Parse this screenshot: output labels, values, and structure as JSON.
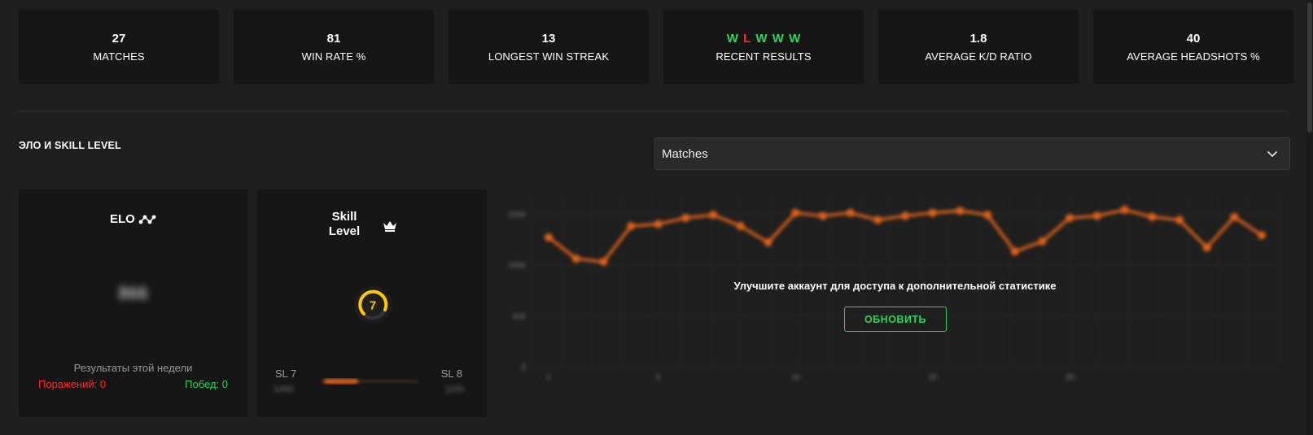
{
  "stats": [
    {
      "value": "27",
      "label": "MATCHES"
    },
    {
      "value": "81",
      "label": "WIN RATE %"
    },
    {
      "value": "13",
      "label": "LONGEST WIN STREAK"
    },
    {
      "value": "",
      "label": "RECENT RESULTS"
    },
    {
      "value": "1.8",
      "label": "AVERAGE K/D RATIO"
    },
    {
      "value": "40",
      "label": "AVERAGE HEADSHOTS %"
    }
  ],
  "recent_results": [
    "W",
    "L",
    "W",
    "W",
    "W"
  ],
  "section": {
    "title": "ЭЛО И SKILL LEVEL"
  },
  "select": {
    "value": "Matches"
  },
  "elo": {
    "title": "ELO",
    "value": "866",
    "week_label": "Результаты этой недели",
    "losses": "Поражений: 0",
    "wins": "Побед: 0"
  },
  "skill": {
    "title_line1": "Skill",
    "title_line2": "Level",
    "level": "7",
    "left_label": "SL 7",
    "right_label": "SL 8",
    "left_sub": "1000",
    "right_sub": "1150"
  },
  "upgrade": {
    "message": "Улучшите аккаунт для доступа к дополнительной статистике",
    "button": "ОБНОВИТЬ"
  },
  "colors": {
    "win": "#32d35a",
    "loss": "#ff2b2b",
    "line": "#e0621a",
    "skill": "#ffc800"
  },
  "chart_data": {
    "type": "line",
    "x": [
      1,
      2,
      3,
      4,
      5,
      6,
      7,
      8,
      9,
      10,
      11,
      12,
      13,
      14,
      15,
      16,
      17,
      18,
      19,
      20,
      21,
      22,
      23,
      24,
      25,
      26,
      27
    ],
    "xticks": [
      "1",
      "5",
      "10",
      "15",
      "20"
    ],
    "yticks": [
      "0",
      "500",
      "1000",
      "1500"
    ],
    "ylim": [
      0,
      1700
    ],
    "series": [
      {
        "values": [
          1270,
          1060,
          1030,
          1380,
          1400,
          1460,
          1490,
          1380,
          1220,
          1510,
          1480,
          1510,
          1440,
          1480,
          1510,
          1530,
          1490,
          1130,
          1230,
          1460,
          1480,
          1540,
          1470,
          1440,
          1170,
          1470,
          1290
        ]
      }
    ]
  }
}
